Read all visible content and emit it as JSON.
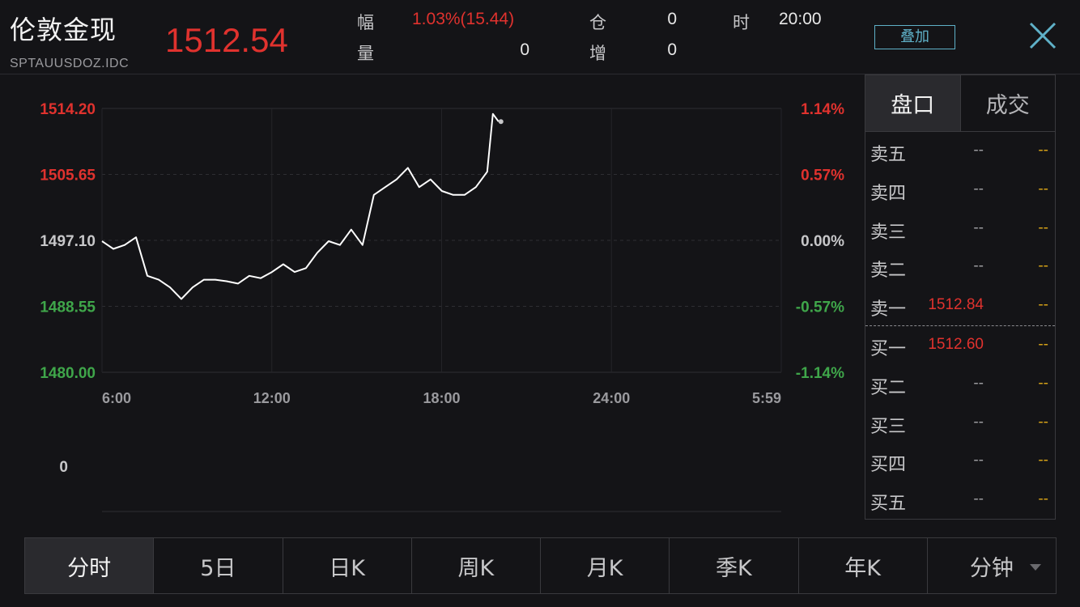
{
  "header": {
    "name": "伦敦金现",
    "code": "SPTAUUSDOZ.IDC",
    "last_price": "1512.54",
    "stats": {
      "change_label": "幅",
      "change_value": "1.03%(15.44)",
      "position_label": "仓",
      "position_value": "0",
      "time_label": "时",
      "time_value": "20:00",
      "volume_label": "量",
      "volume_value": "0",
      "increase_label": "增",
      "increase_value": "0"
    },
    "overlay_button": "叠加",
    "close_icon": "close-icon"
  },
  "chart_data": {
    "type": "line",
    "y_labels_left": [
      "1514.20",
      "1505.65",
      "1497.10",
      "1488.55",
      "1480.00"
    ],
    "y_labels_right": [
      "1.14%",
      "0.57%",
      "0.00%",
      "-0.57%",
      "-1.14%"
    ],
    "x_labels": [
      "6:00",
      "12:00",
      "18:00",
      "24:00",
      "5:59"
    ],
    "volume_label": "0",
    "ylim": [
      1480.0,
      1514.2
    ],
    "reference_price": 1497.1,
    "colors": {
      "up": "#e0322e",
      "down": "#3fa64a",
      "flat": "#c7c7c9",
      "line": "#ffffff"
    },
    "series": [
      {
        "x": [
          "6:00",
          "6:24",
          "6:48",
          "7:12",
          "7:36",
          "8:00",
          "8:24",
          "8:48",
          "9:12",
          "9:36",
          "10:00",
          "10:24",
          "10:48",
          "11:12",
          "11:36",
          "12:00",
          "12:24",
          "12:48",
          "13:12",
          "13:36",
          "14:00",
          "14:24",
          "14:48",
          "15:12",
          "15:36",
          "16:00",
          "16:24",
          "16:48",
          "17:12",
          "17:36",
          "18:00",
          "18:24",
          "18:48",
          "19:12",
          "19:36",
          "19:48",
          "20:00"
        ],
        "values": [
          1497.0,
          1496.0,
          1496.5,
          1497.5,
          1492.5,
          1492.0,
          1491.0,
          1489.5,
          1491.0,
          1492.0,
          1492.0,
          1491.8,
          1491.5,
          1492.5,
          1492.2,
          1493.0,
          1494.0,
          1493.0,
          1493.5,
          1495.5,
          1497.0,
          1496.5,
          1498.5,
          1496.5,
          1503.0,
          1504.0,
          1505.0,
          1506.5,
          1504.0,
          1505.0,
          1503.5,
          1503.0,
          1503.0,
          1504.0,
          1506.0,
          1513.5,
          1512.5
        ]
      }
    ]
  },
  "order_book": {
    "tabs": [
      "盘口",
      "成交"
    ],
    "asks": [
      {
        "name": "卖五",
        "price": "--",
        "vol": "--"
      },
      {
        "name": "卖四",
        "price": "--",
        "vol": "--"
      },
      {
        "name": "卖三",
        "price": "--",
        "vol": "--"
      },
      {
        "name": "卖二",
        "price": "--",
        "vol": "--"
      },
      {
        "name": "卖一",
        "price": "1512.84",
        "vol": "--"
      }
    ],
    "bids": [
      {
        "name": "买一",
        "price": "1512.60",
        "vol": "--"
      },
      {
        "name": "买二",
        "price": "--",
        "vol": "--"
      },
      {
        "name": "买三",
        "price": "--",
        "vol": "--"
      },
      {
        "name": "买四",
        "price": "--",
        "vol": "--"
      },
      {
        "name": "买五",
        "price": "--",
        "vol": "--"
      }
    ]
  },
  "period_tabs": [
    "分时",
    "5日",
    "日K",
    "周K",
    "月K",
    "季K",
    "年K",
    "分钟"
  ]
}
